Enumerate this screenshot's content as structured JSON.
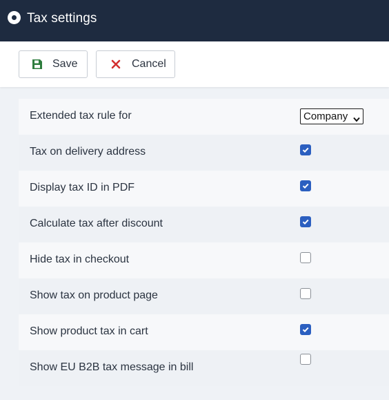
{
  "window": {
    "title": "Tax settings"
  },
  "toolbar": {
    "save_label": "Save",
    "cancel_label": "Cancel",
    "save_icon": "floppy-disk-icon",
    "cancel_icon": "close-icon",
    "save_icon_color": "#2e7d3e",
    "cancel_icon_color": "#d32f2f"
  },
  "settings": {
    "extended_rule": {
      "label": "Extended tax rule for",
      "selected": "Company"
    },
    "rows": [
      {
        "label": "Tax on delivery address",
        "checked": true
      },
      {
        "label": "Display tax ID in PDF",
        "checked": true
      },
      {
        "label": "Calculate tax after discount",
        "checked": true
      },
      {
        "label": "Hide tax in checkout",
        "checked": false
      },
      {
        "label": "Show tax on product page",
        "checked": false
      },
      {
        "label": "Show product tax in cart",
        "checked": true
      },
      {
        "label": "Show EU B2B tax message in bill",
        "checked": false
      }
    ]
  },
  "colors": {
    "header_bg": "#1e2b40",
    "checkbox_checked": "#2b5fc0"
  }
}
